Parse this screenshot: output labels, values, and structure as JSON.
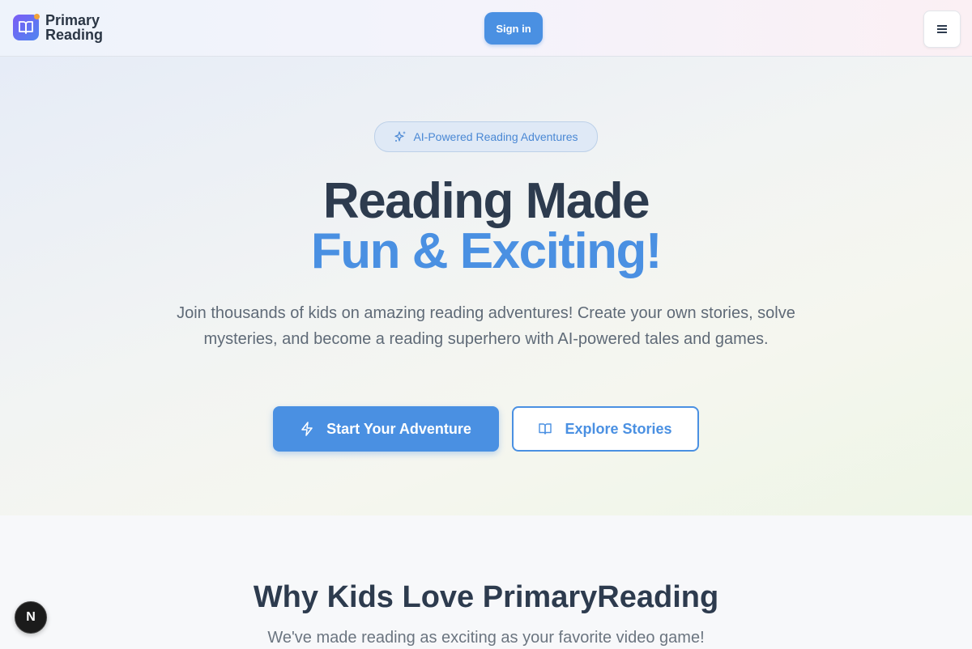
{
  "header": {
    "brand_line1": "Primary",
    "brand_line2": "Reading",
    "signin_label": "Sign in",
    "menu_icon": "hamburger-menu-icon"
  },
  "hero": {
    "badge_text": "AI-Powered Reading Adventures",
    "title_line1": "Reading Made",
    "title_line2": "Fun & Exciting!",
    "lead": "Join thousands of kids on amazing reading adventures! Create your own stories, solve mysteries, and become a reading superhero with AI-powered tales and games.",
    "primary_button": "Start Your Adventure",
    "secondary_button": "Explore Stories"
  },
  "features": {
    "title": "Why Kids Love PrimaryReading",
    "subtitle": "We've made reading as exciting as your favorite video game!"
  },
  "dev_badge": "N",
  "colors": {
    "accent": "#4a90e2",
    "heading": "#2d3b4e",
    "body_text": "#5f6a77"
  }
}
